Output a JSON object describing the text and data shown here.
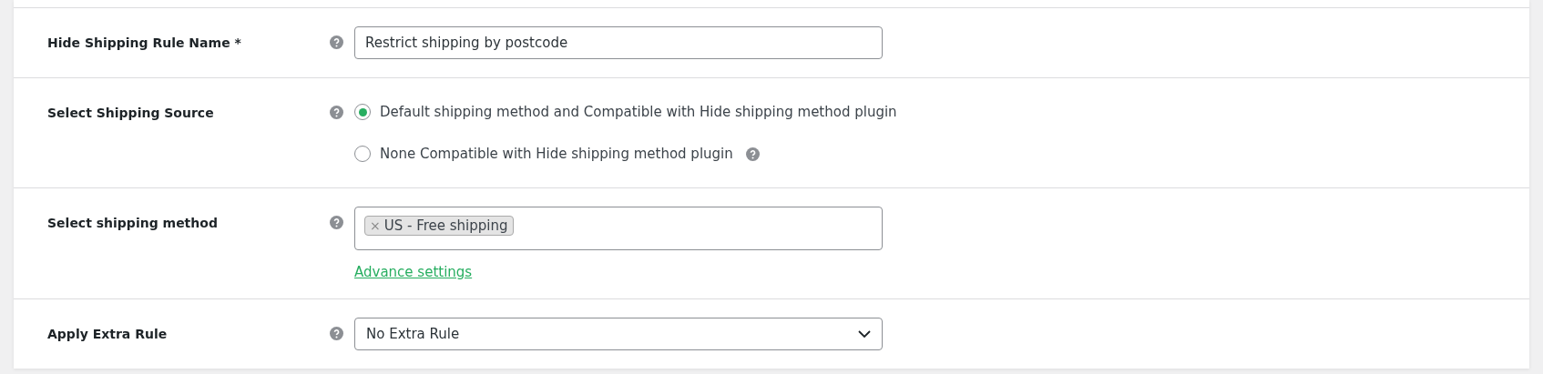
{
  "rows": [
    {
      "kind": "text",
      "label": "Hide Shipping Rule Name *",
      "value": "Restrict shipping by postcode"
    },
    {
      "kind": "radio",
      "label": "Select Shipping Source",
      "options": [
        {
          "label": "Default shipping method and Compatible with Hide shipping method plugin",
          "selected": true,
          "help": false
        },
        {
          "label": "None Compatible with Hide shipping method plugin",
          "selected": false,
          "help": true
        }
      ]
    },
    {
      "kind": "multiselect",
      "label": "Select shipping method",
      "tags": [
        {
          "remove": "×",
          "label": "US - Free shipping"
        }
      ],
      "link": "Advance settings"
    },
    {
      "kind": "select",
      "label": "Apply Extra Rule",
      "value": "No Extra Rule"
    }
  ]
}
